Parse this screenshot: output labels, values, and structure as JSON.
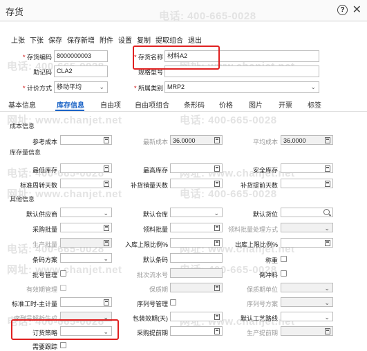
{
  "window": {
    "title": "存货"
  },
  "watermark": {
    "phone": "电话: 400-665-0028",
    "site": "网址: www.chanjet.net"
  },
  "toolbar": [
    "上张",
    "下张",
    "保存",
    "保存新增",
    "附件",
    "设置",
    "复制",
    "提取组合",
    "退出"
  ],
  "header_fields": {
    "code_label": "存货编码",
    "code_value": "8000000003",
    "name_label": "存货名称",
    "name_value": "材料A2",
    "mnemonic_label": "助记码",
    "mnemonic_value": "CLA2",
    "spec_label": "规格型号",
    "spec_value": "",
    "valuation_label": "计价方式",
    "valuation_value": "移动平均",
    "category_label": "所属类别",
    "category_value": "MRP2"
  },
  "tabs": [
    "基本信息",
    "库存信息",
    "自由项",
    "自由项组合",
    "条形码",
    "价格",
    "图片",
    "开票",
    "标签"
  ],
  "sections": {
    "cost": "成本信息",
    "stock": "库存量信息",
    "other": "其他信息"
  },
  "cost": {
    "ref_cost_label": "参考成本",
    "ref_cost_value": "",
    "latest_cost_label": "最新成本",
    "latest_cost_value": "36.0000",
    "avg_cost_label": "平均成本",
    "avg_cost_value": "36.0000"
  },
  "stock": {
    "min_label": "最低库存",
    "max_label": "最高库存",
    "safe_label": "安全库存",
    "turnover_label": "标准周转天数",
    "replenish_days_label": "补货销量天数",
    "replenish_lead_label": "补货提前天数"
  },
  "other": {
    "supplier_label": "默认供应商",
    "warehouse_label": "默认仓库",
    "location_label": "默认货位",
    "batch_label": "采购批量",
    "issue_batch_label": "领料批量",
    "issue_method_label": "领料批量处理方式",
    "prod_batch_label": "生产批量",
    "inbound_ratio_label": "入库上限比例%",
    "outbound_ratio_label": "出库上限比例%",
    "barcode_label": "条码方案",
    "default_barcode_label": "默认条码",
    "weigh_label": "称重",
    "batch_mgmt_label": "批号管理",
    "batch_serial_label": "批次流水号",
    "backflush_label": "倒冲料",
    "expiry_mgmt_label": "有效期管理",
    "shelf_life_label": "保质期",
    "shelf_unit_label": "保质期单位",
    "std_hours_label": "标准工时-主计量",
    "serial_mgmt_label": "序列号管理",
    "serial_scheme_label": "序列号方案",
    "serial_parse_label": "序列号解析生成",
    "pack_days_label": "包装效期(天)",
    "route_label": "默认工艺路线",
    "order_strategy_label": "订货策略",
    "purchase_lead_label": "采购提前期",
    "prod_lead_label": "生产提前期",
    "demand_trace_label": "需要跟踪"
  },
  "colors": {
    "accent": "#1a63c6",
    "highlight": "#e02020"
  }
}
